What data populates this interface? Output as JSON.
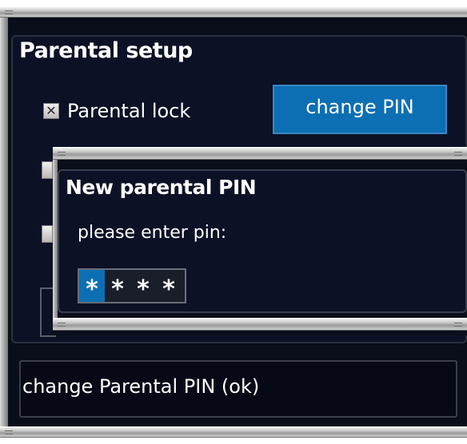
{
  "main_dialog": {
    "title": "Parental setup",
    "parental_lock": {
      "label": "Parental lock",
      "checked": true,
      "check_glyph": "✕"
    },
    "change_pin_button": "change PIN",
    "status_text": "change Parental PIN (ok)"
  },
  "pin_dialog": {
    "title": "New parental PIN",
    "prompt": "please enter pin:",
    "digits": [
      "*",
      "*",
      "*",
      "*"
    ],
    "active_digit_index": 0
  },
  "colors": {
    "background": "#0c1126",
    "accent": "#0d6fb3",
    "text": "#ffffff"
  }
}
